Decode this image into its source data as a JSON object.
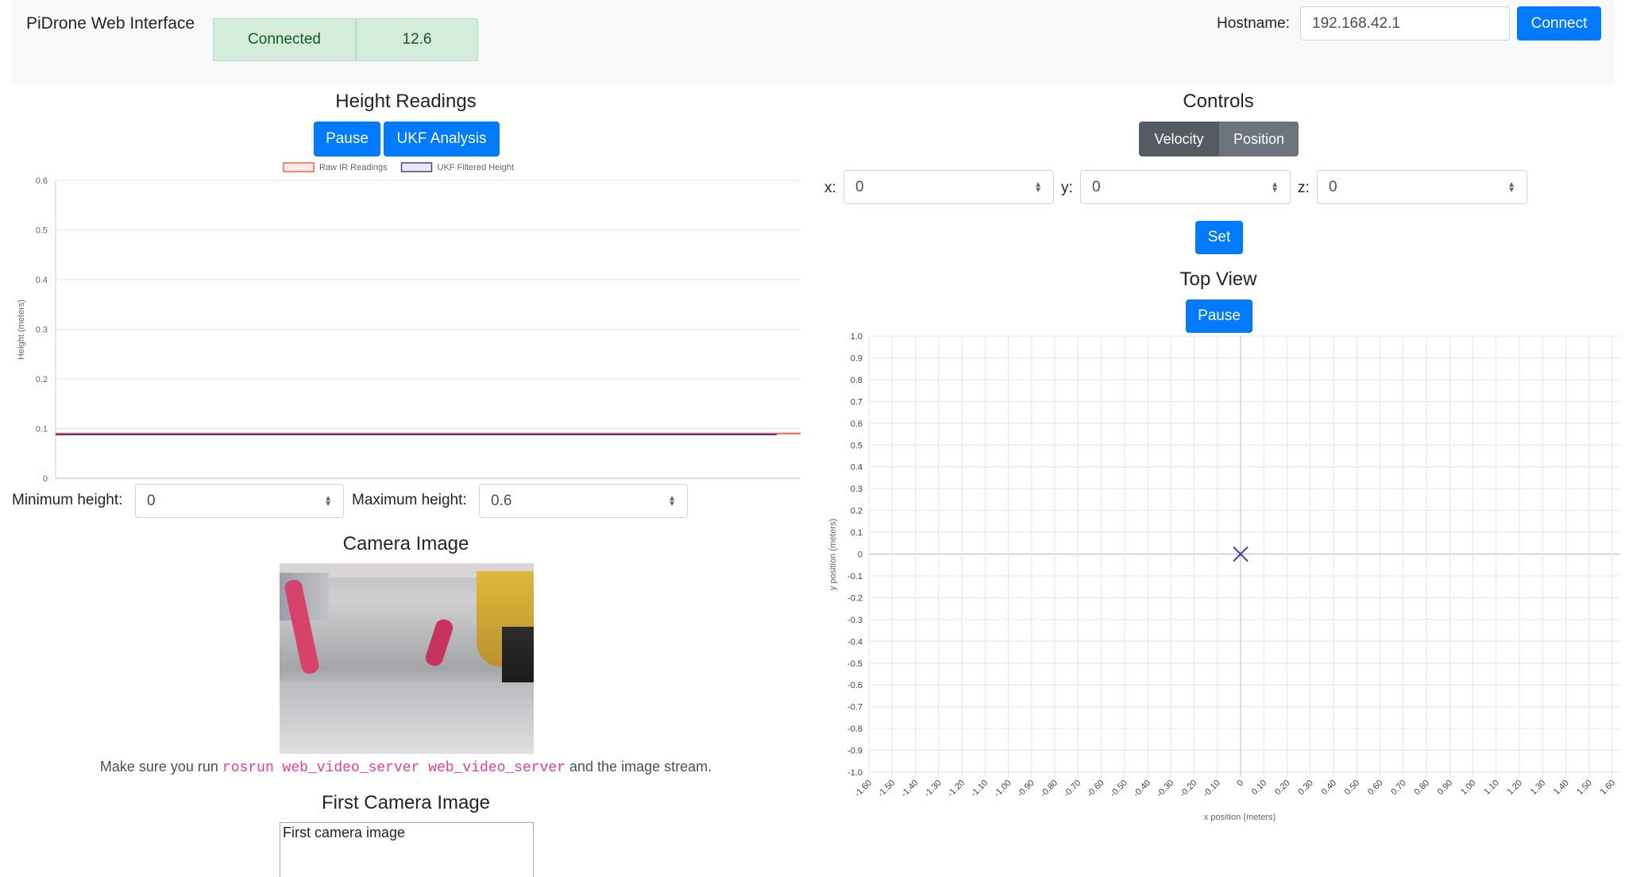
{
  "navbar": {
    "brand": "PiDrone Web Interface",
    "connection_status": "Connected",
    "battery_voltage": "12.6",
    "hostname_label": "Hostname:",
    "hostname_value": "192.168.42.1",
    "connect_label": "Connect"
  },
  "height": {
    "title": "Height Readings",
    "pause_label": "Pause",
    "ukf_label": "UKF Analysis",
    "min_label": "Minimum height:",
    "min_value": "0",
    "max_label": "Maximum height:",
    "max_value": "0.6"
  },
  "controls": {
    "title": "Controls",
    "mode_velocity": "Velocity",
    "mode_position": "Position",
    "x_label": "x:",
    "x_value": "0",
    "y_label": "y:",
    "y_value": "0",
    "z_label": "z:",
    "z_value": "0",
    "set_label": "Set"
  },
  "topview": {
    "title": "Top View",
    "pause_label": "Pause"
  },
  "camera": {
    "title": "Camera Image",
    "note_before": "Make sure you run ",
    "note_command": "rosrun web_video_server web_video_server",
    "note_after": " and the image stream.",
    "first_title": "First Camera Image",
    "first_placeholder": "First camera image"
  },
  "colors": {
    "primary": "#007bff",
    "success_bg": "#d4edda",
    "raw_ir": "#ff6347",
    "ukf": "#4b3fa0"
  },
  "chart_data": [
    {
      "type": "line",
      "title": "",
      "xlabel": "",
      "ylabel": "Height (meters)",
      "ylim": [
        0,
        0.6
      ],
      "yticks": [
        "0",
        "0.1",
        "0.2",
        "0.3",
        "0.4",
        "0.5",
        "0.6"
      ],
      "legend": "top",
      "series": [
        {
          "name": "Raw IR Readings",
          "color": "#ff6347",
          "values": [
            0.09,
            0.09,
            0.09,
            0.09,
            0.09,
            0.09,
            0.09,
            0.09,
            0.09,
            0.09,
            0.09
          ]
        },
        {
          "name": "UKF Filtered Height",
          "color": "#4b3fa0",
          "values": [
            0.088,
            0.088,
            0.088,
            0.088,
            0.088,
            0.088,
            0.088,
            0.088,
            0.088,
            0.088,
            0.088
          ]
        }
      ]
    },
    {
      "type": "scatter",
      "title": "",
      "xlabel": "x position (meters)",
      "ylabel": "y position (meters)",
      "xlim": [
        -1.6,
        1.6
      ],
      "ylim": [
        -1.0,
        1.0
      ],
      "xticks": [
        "-1.60",
        "-1.50",
        "-1.40",
        "-1.30",
        "-1.20",
        "-1.10",
        "-1.00",
        "-0.90",
        "-0.80",
        "-0.70",
        "-0.60",
        "-0.50",
        "-0.40",
        "-0.30",
        "-0.20",
        "-0.10",
        "0",
        "0.10",
        "0.20",
        "0.30",
        "0.40",
        "0.50",
        "0.60",
        "0.70",
        "0.80",
        "0.90",
        "1.00",
        "1.10",
        "1.20",
        "1.30",
        "1.40",
        "1.50",
        "1.60"
      ],
      "yticks": [
        "1.0",
        "0.9",
        "0.8",
        "0.7",
        "0.6",
        "0.5",
        "0.4",
        "0.3",
        "0.2",
        "0.1",
        "0",
        "-0.1",
        "-0.2",
        "-0.3",
        "-0.4",
        "-0.5",
        "-0.6",
        "-0.7",
        "-0.8",
        "-0.9",
        "-1.0"
      ],
      "grid": true,
      "points": [
        {
          "x": 0,
          "y": 0,
          "marker": "x",
          "color": "#4b3fa0"
        }
      ]
    }
  ]
}
